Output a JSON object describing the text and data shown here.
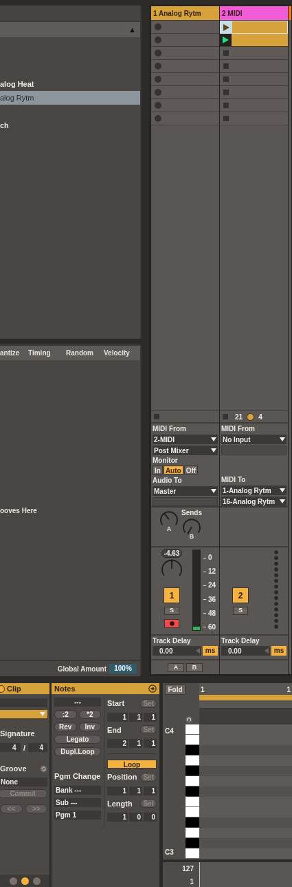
{
  "browser": {
    "sort_indicator": "▲",
    "items": [
      {
        "label": "alog Heat",
        "kind": "folder",
        "selected": false
      },
      {
        "label": "alog Rytm",
        "kind": "device",
        "selected": true
      },
      {
        "label": "ch",
        "kind": "folder",
        "selected": false
      }
    ]
  },
  "groove_pool": {
    "columns": [
      "antize",
      "Timing",
      "Random",
      "Velocity"
    ],
    "hint": "ooves Here",
    "global_label": "Global Amount",
    "global_value": "100%"
  },
  "tracks": [
    {
      "name": "1 Analog Rytm",
      "color": "#d8a23a",
      "slots": [
        {
          "kind": "record"
        },
        {
          "kind": "record"
        },
        {
          "kind": "record"
        },
        {
          "kind": "record"
        },
        {
          "kind": "record"
        },
        {
          "kind": "record"
        },
        {
          "kind": "record"
        },
        {
          "kind": "record"
        }
      ],
      "io": {
        "input_label": "MIDI From",
        "input": "2-MIDI",
        "input_channel": "Post Mixer",
        "monitor": {
          "label": "Monitor",
          "options": [
            {
              "label": "In",
              "selected": false
            },
            {
              "label": "Auto",
              "selected": true
            },
            {
              "label": "Off",
              "selected": false
            }
          ]
        },
        "output_label": "Audio To",
        "output": "Master"
      },
      "sends": {
        "label": "Sends",
        "knobs": [
          "A",
          "B"
        ]
      },
      "mixer": {
        "volume": "-4.63",
        "number": "1",
        "active": true,
        "solo": "S",
        "soloed": false,
        "armed": true,
        "scale": [
          "0",
          "12",
          "24",
          "36",
          "48",
          "60"
        ],
        "level": 0.04
      },
      "delay": {
        "label": "Track Delay",
        "value": "0.00",
        "unit": "ms"
      },
      "crossfade": [
        "A",
        "B"
      ]
    },
    {
      "name": "2 MIDI",
      "color": "#f25ad8",
      "slots": [
        {
          "kind": "clip",
          "selected": true,
          "playing": false
        },
        {
          "kind": "clip",
          "selected": false,
          "playing": true
        },
        {
          "kind": "stop"
        },
        {
          "kind": "stop"
        },
        {
          "kind": "stop"
        },
        {
          "kind": "stop"
        },
        {
          "kind": "stop"
        },
        {
          "kind": "stop"
        }
      ],
      "status": [
        "21",
        "4"
      ],
      "io": {
        "input_label": "MIDI From",
        "input": "No Input",
        "output_label": "MIDI To",
        "output": "1-Analog Rytm",
        "output_channel": "16-Analog Rytm"
      },
      "mixer": {
        "number": "2",
        "active": true,
        "solo": "S",
        "soloed": false
      },
      "delay": {
        "label": "Track Delay",
        "value": "0.00",
        "unit": "ms"
      }
    },
    {
      "color": "#f27a1f"
    }
  ],
  "clip_panel": {
    "title": "Clip",
    "signature_label": "Signature",
    "numerator": "4",
    "separator": "/",
    "denominator": "4",
    "groove_label": "Groove",
    "groove": "None",
    "commit": "Commit",
    "nav": [
      "<<",
      ">>"
    ],
    "view_buttons": [
      {
        "selected": false
      },
      {
        "selected": true
      },
      {
        "selected": false
      }
    ]
  },
  "notes_panel": {
    "title": "Notes",
    "transpose": "---",
    "buttons": [
      ":2",
      "*2",
      "Rev",
      "Inv",
      "Legato",
      "Dupl.Loop"
    ],
    "pgm_label": "Pgm Change",
    "program_fields": [
      "Bank ---",
      "Sub ---",
      "Pgm 1"
    ],
    "markers": [
      {
        "label": "Start",
        "set": "Set",
        "values": [
          "1",
          "1",
          "1"
        ]
      },
      {
        "label": "End",
        "set": "Set",
        "values": [
          "2",
          "1",
          "1"
        ]
      }
    ],
    "loop": {
      "label": "Loop",
      "on": true
    },
    "loop_markers": [
      {
        "label": "Position",
        "set": "Set",
        "values": [
          "1",
          "1",
          "1"
        ]
      },
      {
        "label": "Length",
        "set": "Set",
        "values": [
          "1",
          "0",
          "0"
        ]
      }
    ]
  },
  "piano_roll": {
    "fold": "Fold",
    "ruler": [
      "1",
      "1"
    ],
    "notes": [
      "C4",
      "C3"
    ],
    "velocity": [
      "127",
      "1"
    ]
  }
}
